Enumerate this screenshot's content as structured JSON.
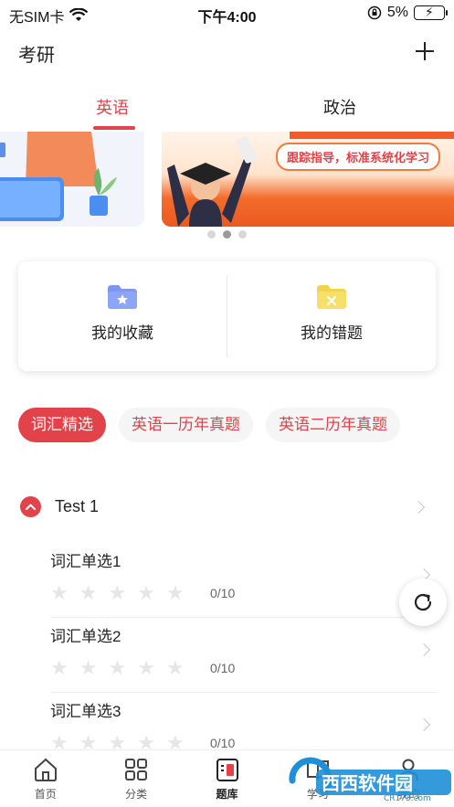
{
  "status_bar": {
    "carrier": "无SIM卡",
    "time": "下午4:00",
    "battery": "5%"
  },
  "header": {
    "title": "考研"
  },
  "tabs": [
    {
      "label": "英语",
      "active": true
    },
    {
      "label": "政治",
      "active": false
    }
  ],
  "banner": {
    "caption": "跟踪指导，标准系统化学习",
    "dots": 3,
    "active_dot": 1
  },
  "quick_actions": [
    {
      "label": "我的收藏",
      "icon": "star-folder-icon"
    },
    {
      "label": "我的错题",
      "icon": "error-folder-icon"
    }
  ],
  "chips": [
    {
      "label": "词汇精选",
      "active": true
    },
    {
      "label": "英语一历年真题",
      "active": false
    },
    {
      "label": "英语二历年真题",
      "active": false
    }
  ],
  "section": {
    "title": "Test 1"
  },
  "items": [
    {
      "title": "词汇单选1",
      "progress": "0/10",
      "stars": 0
    },
    {
      "title": "词汇单选2",
      "progress": "0/10",
      "stars": 0
    },
    {
      "title": "词汇单选3",
      "progress": "0/10",
      "stars": 0
    }
  ],
  "bottom_nav": [
    {
      "label": "首页",
      "icon": "home-icon"
    },
    {
      "label": "分类",
      "icon": "grid-icon"
    },
    {
      "label": "题库",
      "icon": "question-bank-icon",
      "active": true
    },
    {
      "label": "学习",
      "icon": "book-icon"
    },
    {
      "label": "我的",
      "icon": "profile-icon"
    }
  ],
  "watermark": {
    "text": "西西软件园",
    "sub": "CR173.com"
  },
  "colors": {
    "accent": "#e2434b",
    "orange": "#f36c2c"
  }
}
